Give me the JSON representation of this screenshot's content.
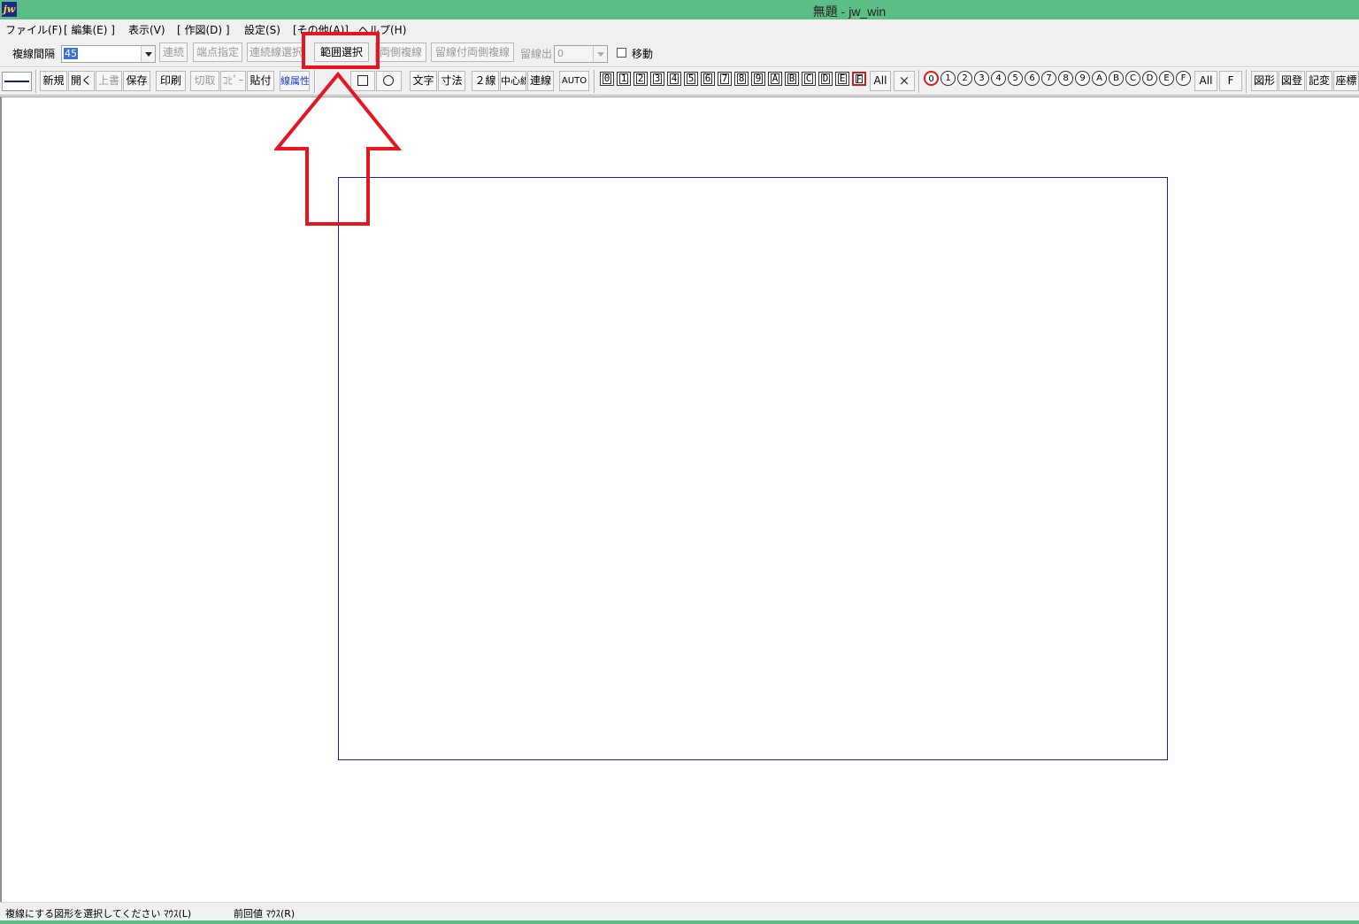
{
  "window": {
    "title": "無題 - jw_win",
    "app_icon_label": "jw"
  },
  "menu": [
    "ファイル(F)",
    "[ 編集(E) ]",
    "表示(V)",
    "[ 作図(D) ]",
    "設定(S)",
    "[その他(A)]",
    "ヘルプ(H)"
  ],
  "toolbar1": {
    "spacing_label": "複線間隔",
    "spacing_value": "45",
    "btn_continuous": "連続",
    "btn_endpoint": "端点指定",
    "btn_chain_select": "連続線選択",
    "btn_range_select": "範囲選択",
    "btn_both_sides": "両側複線",
    "btn_both_sides_stop": "留線付両側複線",
    "stop_label": "留線出",
    "stop_value": "0",
    "move_label": "移動"
  },
  "toolbar2": {
    "new": "新規",
    "open": "開く",
    "overwrite": "上書",
    "save": "保存",
    "print": "印刷",
    "cut": "切取",
    "copy": "ｺﾋﾟｰ",
    "paste": "貼付",
    "line_attr": "線属性",
    "text": "文字",
    "dimension": "寸法",
    "double_line": "２線",
    "center_line": "中心線",
    "chain_line": "連線",
    "auto": "AUTO"
  },
  "layers": [
    "0",
    "1",
    "2",
    "3",
    "4",
    "5",
    "6",
    "7",
    "8",
    "9",
    "A",
    "B",
    "C",
    "D",
    "E",
    "F"
  ],
  "layers_all": "All",
  "layer_groups": [
    "0",
    "1",
    "2",
    "3",
    "4",
    "5",
    "6",
    "7",
    "8",
    "9",
    "A",
    "B",
    "C",
    "D",
    "E",
    "F"
  ],
  "layer_groups_all": "All",
  "layer_groups_f": "F",
  "right_tools": {
    "figure": "図形",
    "register": "図登",
    "notation": "記変",
    "coords": "座標"
  },
  "status": {
    "prompt": "複線にする図形を選択してください  ﾏｳｽ(L)",
    "previous": "前回値  ﾏｳｽ(R)"
  },
  "colors": {
    "titlebar": "#5cbd87",
    "frame": "#1a1ab8",
    "annotation": "#e8141e"
  }
}
